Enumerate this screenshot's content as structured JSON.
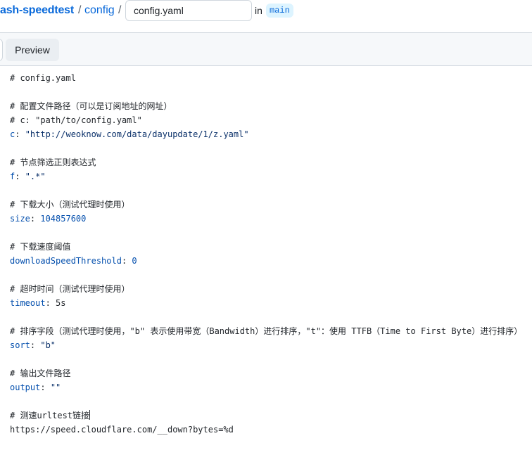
{
  "breadcrumb": {
    "repo": "ash-speedtest",
    "separator": "/",
    "folder": "config"
  },
  "filename_input": {
    "value": "config.yaml"
  },
  "branch": {
    "in_label": "in",
    "name": "main"
  },
  "tabs": {
    "preview_label": "Preview"
  },
  "editor": {
    "lines": {
      "l1": "# config.yaml",
      "l3": "# 配置文件路径（可以是订阅地址的网址）",
      "l4": "# c: \"path/to/config.yaml\"",
      "l5_key": "c",
      "l5_colon": ": ",
      "l5_value": "\"http://weoknow.com/data/dayupdate/1/z.yaml\"",
      "l7": "# 节点筛选正则表达式",
      "l8_key": "f",
      "l8_colon": ": ",
      "l8_value": "\".*\"",
      "l10": "# 下载大小（测试代理时使用）",
      "l11_key": "size",
      "l11_colon": ": ",
      "l11_value": "104857600",
      "l13": "# 下载速度阈值",
      "l14_key": "downloadSpeedThreshold",
      "l14_colon": ": ",
      "l14_value": "0",
      "l16": "# 超时时间（测试代理时使用）",
      "l17_key": "timeout",
      "l17_colon": ": ",
      "l17_value": "5s",
      "l19": "# 排序字段（测试代理时使用，\"b\" 表示使用带宽（Bandwidth）进行排序，\"t\"：使用 TTFB（Time to First Byte）进行排序）",
      "l20_key": "sort",
      "l20_colon": ": ",
      "l20_value": "\"b\"",
      "l22": "# 输出文件路径",
      "l23_key": "output",
      "l23_colon": ": ",
      "l23_value": "\"\"",
      "l25": "# 测速urltest链接",
      "l26": "https://speed.cloudflare.com/__down?bytes=%d"
    }
  }
}
